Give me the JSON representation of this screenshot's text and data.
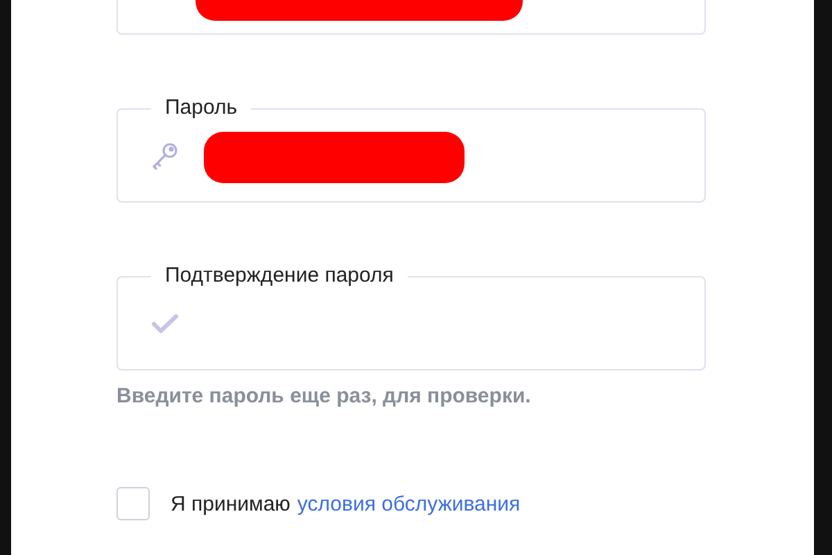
{
  "fields": [
    {
      "kind": "plain",
      "value_redacted": true
    },
    {
      "kind": "password",
      "label": "Пароль",
      "value_redacted": true
    },
    {
      "kind": "confirm",
      "label": "Подтверждение пароля",
      "value_redacted": false,
      "hint": "Введите пароль еще раз, для проверки."
    }
  ],
  "terms": {
    "checked": false,
    "text": "Я принимаю",
    "link": "условия обслуживания"
  }
}
